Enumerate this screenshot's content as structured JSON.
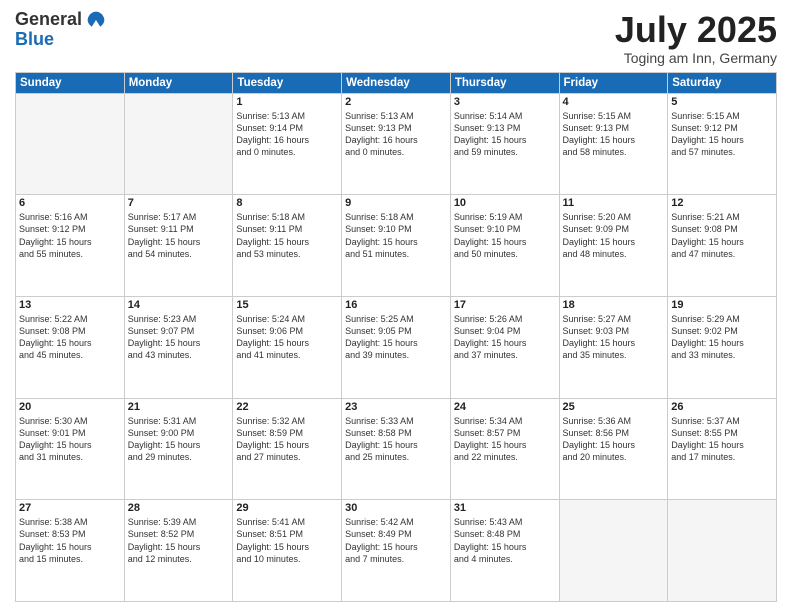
{
  "logo": {
    "general": "General",
    "blue": "Blue"
  },
  "title": "July 2025",
  "location": "Toging am Inn, Germany",
  "days_of_week": [
    "Sunday",
    "Monday",
    "Tuesday",
    "Wednesday",
    "Thursday",
    "Friday",
    "Saturday"
  ],
  "weeks": [
    [
      {
        "day": "",
        "info": ""
      },
      {
        "day": "",
        "info": ""
      },
      {
        "day": "1",
        "info": "Sunrise: 5:13 AM\nSunset: 9:14 PM\nDaylight: 16 hours\nand 0 minutes."
      },
      {
        "day": "2",
        "info": "Sunrise: 5:13 AM\nSunset: 9:13 PM\nDaylight: 16 hours\nand 0 minutes."
      },
      {
        "day": "3",
        "info": "Sunrise: 5:14 AM\nSunset: 9:13 PM\nDaylight: 15 hours\nand 59 minutes."
      },
      {
        "day": "4",
        "info": "Sunrise: 5:15 AM\nSunset: 9:13 PM\nDaylight: 15 hours\nand 58 minutes."
      },
      {
        "day": "5",
        "info": "Sunrise: 5:15 AM\nSunset: 9:12 PM\nDaylight: 15 hours\nand 57 minutes."
      }
    ],
    [
      {
        "day": "6",
        "info": "Sunrise: 5:16 AM\nSunset: 9:12 PM\nDaylight: 15 hours\nand 55 minutes."
      },
      {
        "day": "7",
        "info": "Sunrise: 5:17 AM\nSunset: 9:11 PM\nDaylight: 15 hours\nand 54 minutes."
      },
      {
        "day": "8",
        "info": "Sunrise: 5:18 AM\nSunset: 9:11 PM\nDaylight: 15 hours\nand 53 minutes."
      },
      {
        "day": "9",
        "info": "Sunrise: 5:18 AM\nSunset: 9:10 PM\nDaylight: 15 hours\nand 51 minutes."
      },
      {
        "day": "10",
        "info": "Sunrise: 5:19 AM\nSunset: 9:10 PM\nDaylight: 15 hours\nand 50 minutes."
      },
      {
        "day": "11",
        "info": "Sunrise: 5:20 AM\nSunset: 9:09 PM\nDaylight: 15 hours\nand 48 minutes."
      },
      {
        "day": "12",
        "info": "Sunrise: 5:21 AM\nSunset: 9:08 PM\nDaylight: 15 hours\nand 47 minutes."
      }
    ],
    [
      {
        "day": "13",
        "info": "Sunrise: 5:22 AM\nSunset: 9:08 PM\nDaylight: 15 hours\nand 45 minutes."
      },
      {
        "day": "14",
        "info": "Sunrise: 5:23 AM\nSunset: 9:07 PM\nDaylight: 15 hours\nand 43 minutes."
      },
      {
        "day": "15",
        "info": "Sunrise: 5:24 AM\nSunset: 9:06 PM\nDaylight: 15 hours\nand 41 minutes."
      },
      {
        "day": "16",
        "info": "Sunrise: 5:25 AM\nSunset: 9:05 PM\nDaylight: 15 hours\nand 39 minutes."
      },
      {
        "day": "17",
        "info": "Sunrise: 5:26 AM\nSunset: 9:04 PM\nDaylight: 15 hours\nand 37 minutes."
      },
      {
        "day": "18",
        "info": "Sunrise: 5:27 AM\nSunset: 9:03 PM\nDaylight: 15 hours\nand 35 minutes."
      },
      {
        "day": "19",
        "info": "Sunrise: 5:29 AM\nSunset: 9:02 PM\nDaylight: 15 hours\nand 33 minutes."
      }
    ],
    [
      {
        "day": "20",
        "info": "Sunrise: 5:30 AM\nSunset: 9:01 PM\nDaylight: 15 hours\nand 31 minutes."
      },
      {
        "day": "21",
        "info": "Sunrise: 5:31 AM\nSunset: 9:00 PM\nDaylight: 15 hours\nand 29 minutes."
      },
      {
        "day": "22",
        "info": "Sunrise: 5:32 AM\nSunset: 8:59 PM\nDaylight: 15 hours\nand 27 minutes."
      },
      {
        "day": "23",
        "info": "Sunrise: 5:33 AM\nSunset: 8:58 PM\nDaylight: 15 hours\nand 25 minutes."
      },
      {
        "day": "24",
        "info": "Sunrise: 5:34 AM\nSunset: 8:57 PM\nDaylight: 15 hours\nand 22 minutes."
      },
      {
        "day": "25",
        "info": "Sunrise: 5:36 AM\nSunset: 8:56 PM\nDaylight: 15 hours\nand 20 minutes."
      },
      {
        "day": "26",
        "info": "Sunrise: 5:37 AM\nSunset: 8:55 PM\nDaylight: 15 hours\nand 17 minutes."
      }
    ],
    [
      {
        "day": "27",
        "info": "Sunrise: 5:38 AM\nSunset: 8:53 PM\nDaylight: 15 hours\nand 15 minutes."
      },
      {
        "day": "28",
        "info": "Sunrise: 5:39 AM\nSunset: 8:52 PM\nDaylight: 15 hours\nand 12 minutes."
      },
      {
        "day": "29",
        "info": "Sunrise: 5:41 AM\nSunset: 8:51 PM\nDaylight: 15 hours\nand 10 minutes."
      },
      {
        "day": "30",
        "info": "Sunrise: 5:42 AM\nSunset: 8:49 PM\nDaylight: 15 hours\nand 7 minutes."
      },
      {
        "day": "31",
        "info": "Sunrise: 5:43 AM\nSunset: 8:48 PM\nDaylight: 15 hours\nand 4 minutes."
      },
      {
        "day": "",
        "info": ""
      },
      {
        "day": "",
        "info": ""
      }
    ]
  ]
}
